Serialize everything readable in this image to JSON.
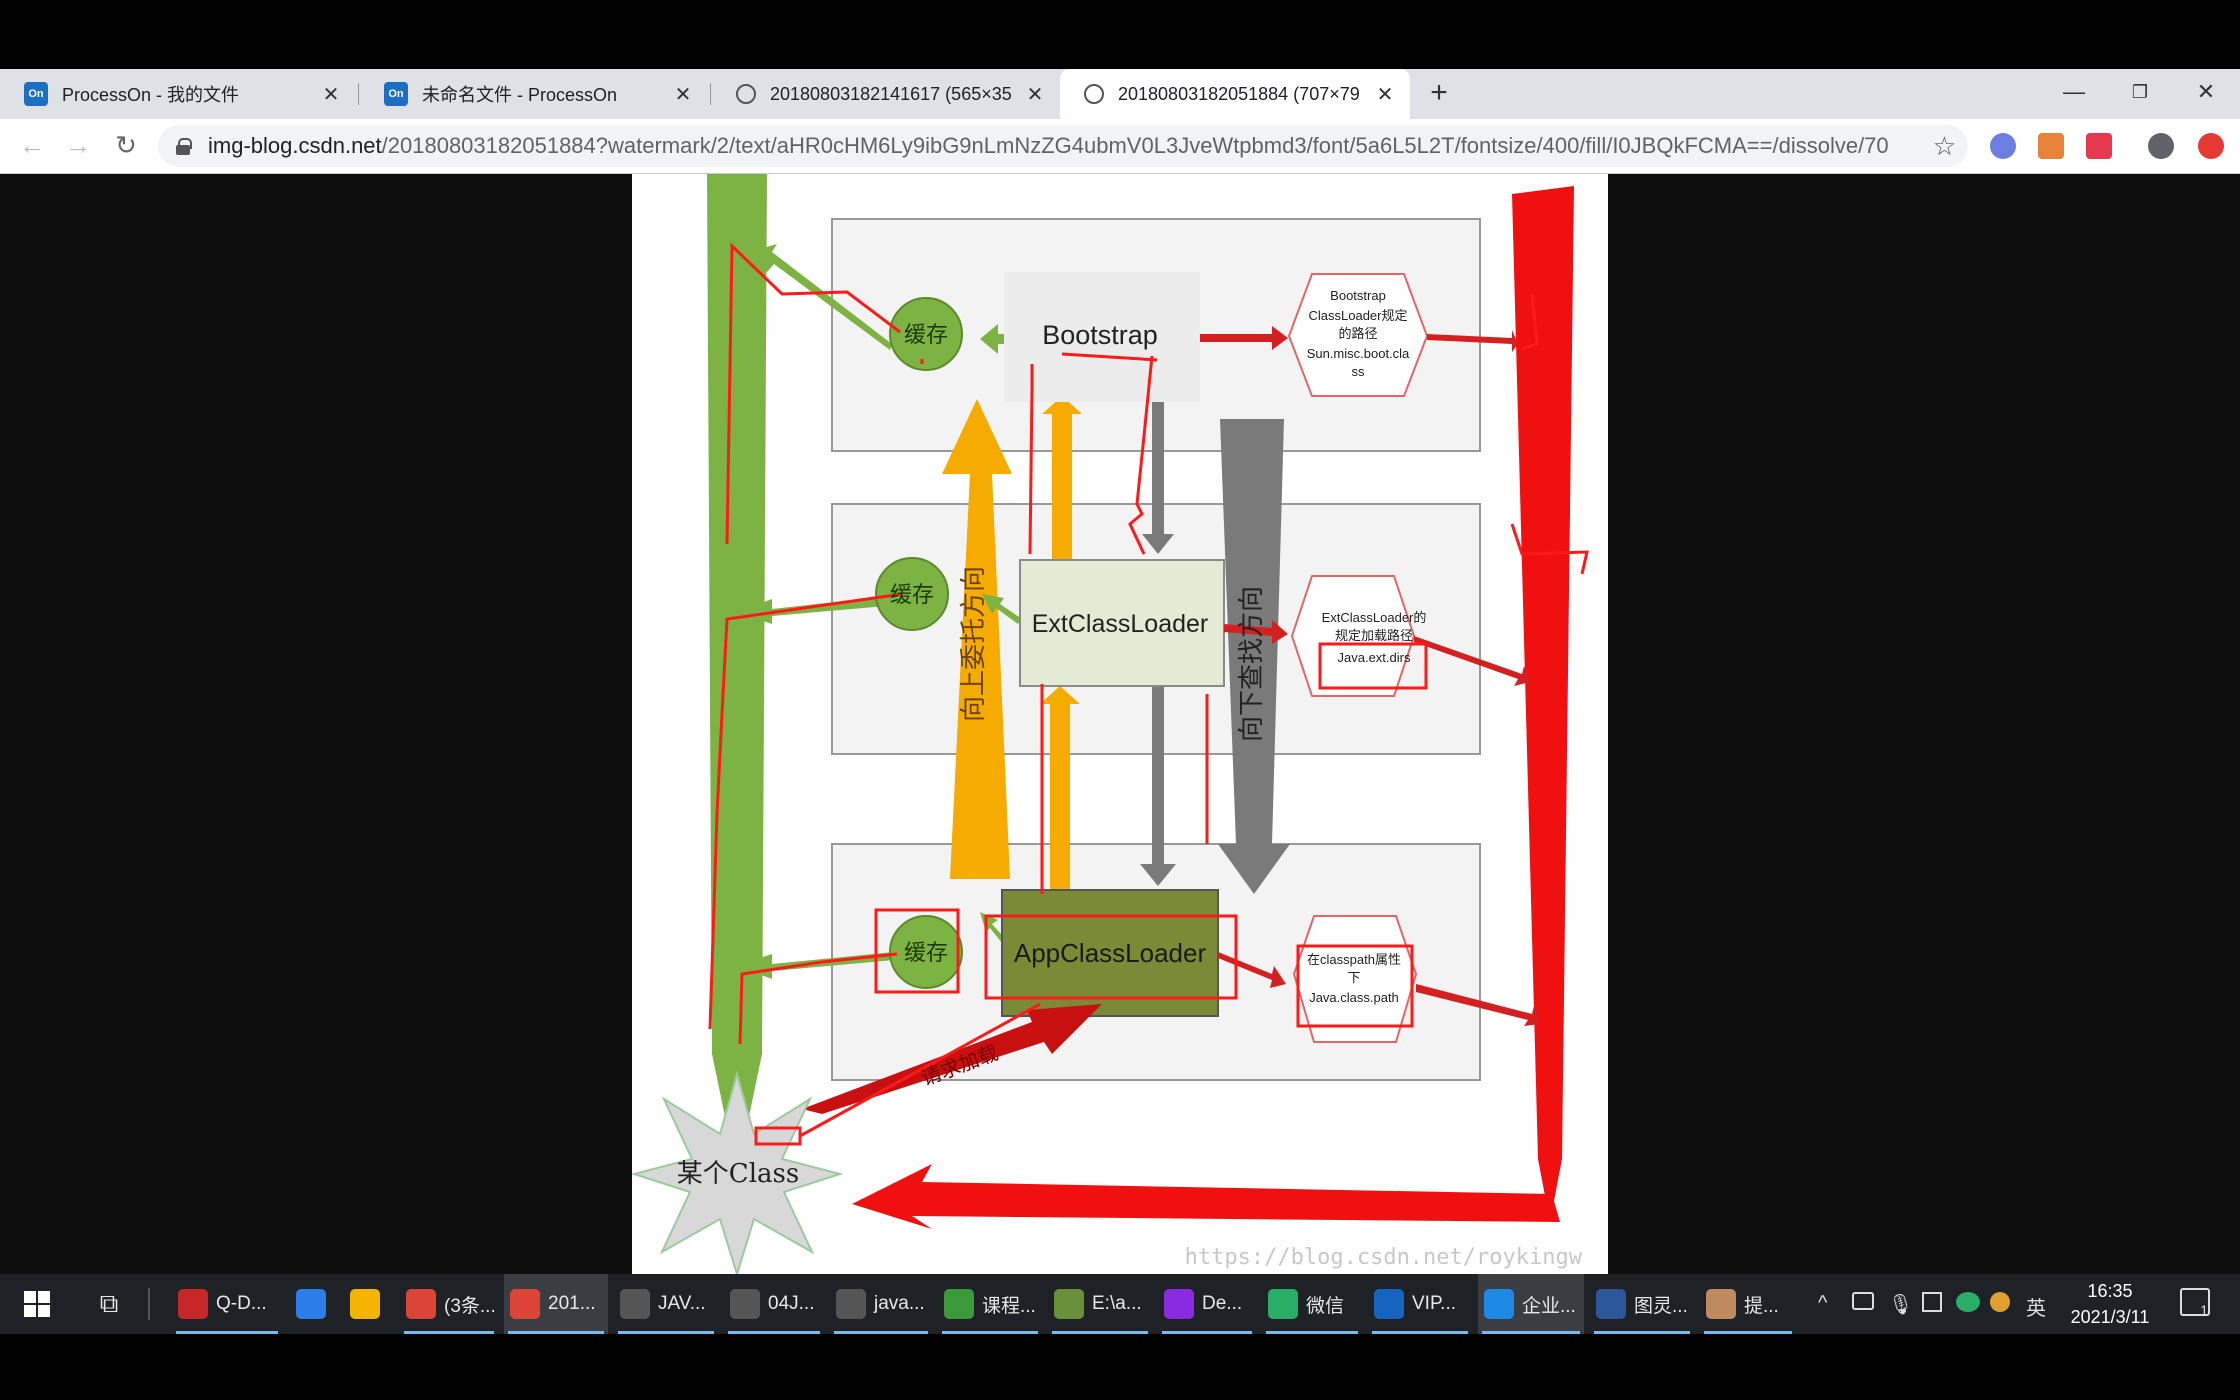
{
  "browser": {
    "tabs": [
      {
        "title": "ProcessOn - 我的文件",
        "icon": "processon-icon",
        "fav": "On"
      },
      {
        "title": "未命名文件 - ProcessOn",
        "icon": "processon-icon",
        "fav": "On"
      },
      {
        "title": "20180803182141617 (565×35",
        "icon": "globe-icon",
        "fav": ""
      },
      {
        "title": "20180803182051884 (707×79",
        "icon": "globe-icon",
        "fav": ""
      }
    ],
    "active_tab": 3,
    "url_host": "img-blog.csdn.net",
    "url_path": "/20180803182051884?watermark/2/text/aHR0cHM6Ly9ibG9nLmNzZG4ubmV0L3JveWtpbmd3/font/5a6L5L2T/fontsize/400/fill/I0JBQkFCMA==/dissolve/70"
  },
  "diagram": {
    "cache_label": "缓存",
    "bootstrap_label": "Bootstrap",
    "ext_label": "ExtClassLoader",
    "app_label": "AppClassLoader",
    "boot_path_lines": [
      "Bootstrap",
      "ClassLoader规定",
      "的路径",
      "Sun.misc.boot.cla",
      "ss"
    ],
    "ext_path_lines": [
      "ExtClassLoader的",
      "规定加载路径",
      "Java.ext.dirs"
    ],
    "app_path_lines": [
      "在classpath属性",
      "下",
      "Java.class.path"
    ],
    "up_delegate_label": "向上委托方向",
    "down_search_label": "向下查找方向",
    "request_label": "请求加载",
    "class_label": "某个Class",
    "watermark": "https://blog.csdn.net/roykingw"
  },
  "taskbar": {
    "items": [
      {
        "label": "Q-D...",
        "icon": "app-icon",
        "color": "#c62828"
      },
      {
        "label": "",
        "icon": "pen-icon",
        "color": "#2b7de9"
      },
      {
        "label": "",
        "icon": "pinwheel-icon",
        "color": "#f4b400"
      },
      {
        "label": "(3条...",
        "icon": "chrome-icon",
        "color": "#db4437"
      },
      {
        "label": "201...",
        "icon": "chrome-icon",
        "color": "#db4437"
      },
      {
        "label": "JAV...",
        "icon": "typora-icon",
        "color": "#555"
      },
      {
        "label": "04J...",
        "icon": "typora-icon",
        "color": "#555"
      },
      {
        "label": "java...",
        "icon": "typora-icon",
        "color": "#555"
      },
      {
        "label": "课程...",
        "icon": "notepad-icon",
        "color": "#3a9a3a"
      },
      {
        "label": "E:\\a...",
        "icon": "image-icon",
        "color": "#6a8f3a"
      },
      {
        "label": "De...",
        "icon": "intellij-icon",
        "color": "#8a2be2"
      },
      {
        "label": "微信",
        "icon": "wechat-icon",
        "color": "#2aae67"
      },
      {
        "label": "VIP...",
        "icon": "pdf-icon",
        "color": "#1565c0"
      },
      {
        "label": "企业...",
        "icon": "enterprise-icon",
        "color": "#1e88e5"
      },
      {
        "label": "图灵...",
        "icon": "word-icon",
        "color": "#2b579a"
      },
      {
        "label": "提...",
        "icon": "avatar-icon",
        "color": "#c08a60"
      }
    ],
    "ime": "英",
    "time": "16:35",
    "date": "2021/3/11",
    "notif_count": "1"
  }
}
